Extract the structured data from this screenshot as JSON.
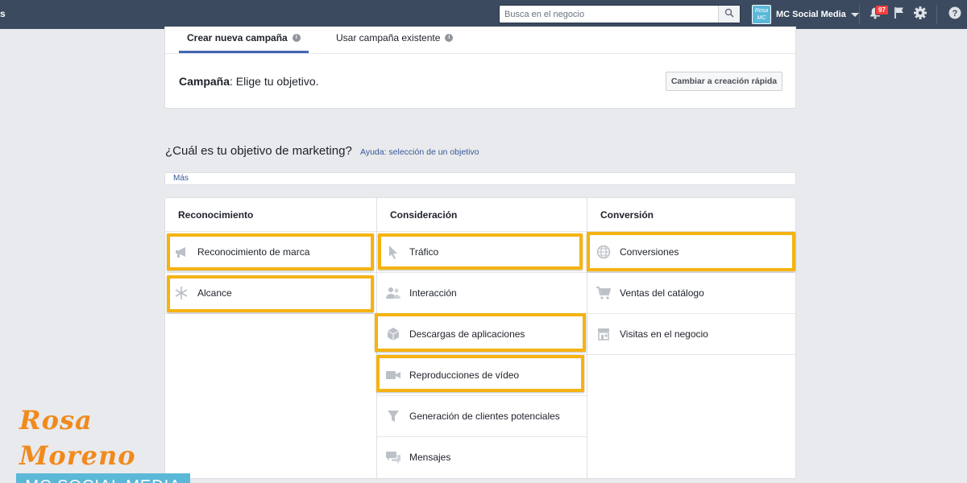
{
  "topbar": {
    "edge_text": "s",
    "search_placeholder": "Busca en el negocio",
    "account_logo": "Rosa MC",
    "account_name": "MC Social Media",
    "notifications_count": "97"
  },
  "campaign_card": {
    "tabs": [
      {
        "label": "Crear nueva campaña",
        "active": true
      },
      {
        "label": "Usar campaña existente",
        "active": false
      }
    ],
    "campaign_label": "Campaña",
    "campaign_text": ": Elige tu objetivo.",
    "quick_create_button": "Cambiar a creación rápida"
  },
  "question": {
    "title": "¿Cuál es tu objetivo de marketing?",
    "help_link": "Ayuda: selección de un objetivo"
  },
  "more_link": "Más",
  "columns": [
    {
      "title": "Reconocimiento",
      "items": [
        {
          "label": "Reconocimiento de marca",
          "icon": "megaphone-icon",
          "highlighted": true
        },
        {
          "label": "Alcance",
          "icon": "asterisk-icon",
          "highlighted": true
        }
      ]
    },
    {
      "title": "Consideración",
      "items": [
        {
          "label": "Tráfico",
          "icon": "cursor-icon",
          "highlighted": true
        },
        {
          "label": "Interacción",
          "icon": "people-icon",
          "highlighted": false
        },
        {
          "label": "Descargas de aplicaciones",
          "icon": "box-icon",
          "highlighted": true
        },
        {
          "label": "Reproducciones de vídeo",
          "icon": "video-camera-icon",
          "highlighted": true
        },
        {
          "label": "Generación de clientes potenciales",
          "icon": "funnel-icon",
          "highlighted": false
        },
        {
          "label": "Mensajes",
          "icon": "chat-bubbles-icon",
          "highlighted": false
        }
      ]
    },
    {
      "title": "Conversión",
      "items": [
        {
          "label": "Conversiones",
          "icon": "globe-icon",
          "highlighted": true
        },
        {
          "label": "Ventas del catálogo",
          "icon": "shopping-cart-icon",
          "highlighted": false
        },
        {
          "label": "Visitas en el negocio",
          "icon": "store-icon",
          "highlighted": false
        }
      ]
    }
  ],
  "watermark": {
    "script_name": "Rosa Moreno",
    "band_text": "MC SOCIAL MEDIA"
  },
  "colors": {
    "topbar": "#3b4a5e",
    "highlight": "#f5b312",
    "link": "#365899",
    "watermark_orange": "#f08a1d",
    "watermark_blue": "#5bb8d8"
  }
}
